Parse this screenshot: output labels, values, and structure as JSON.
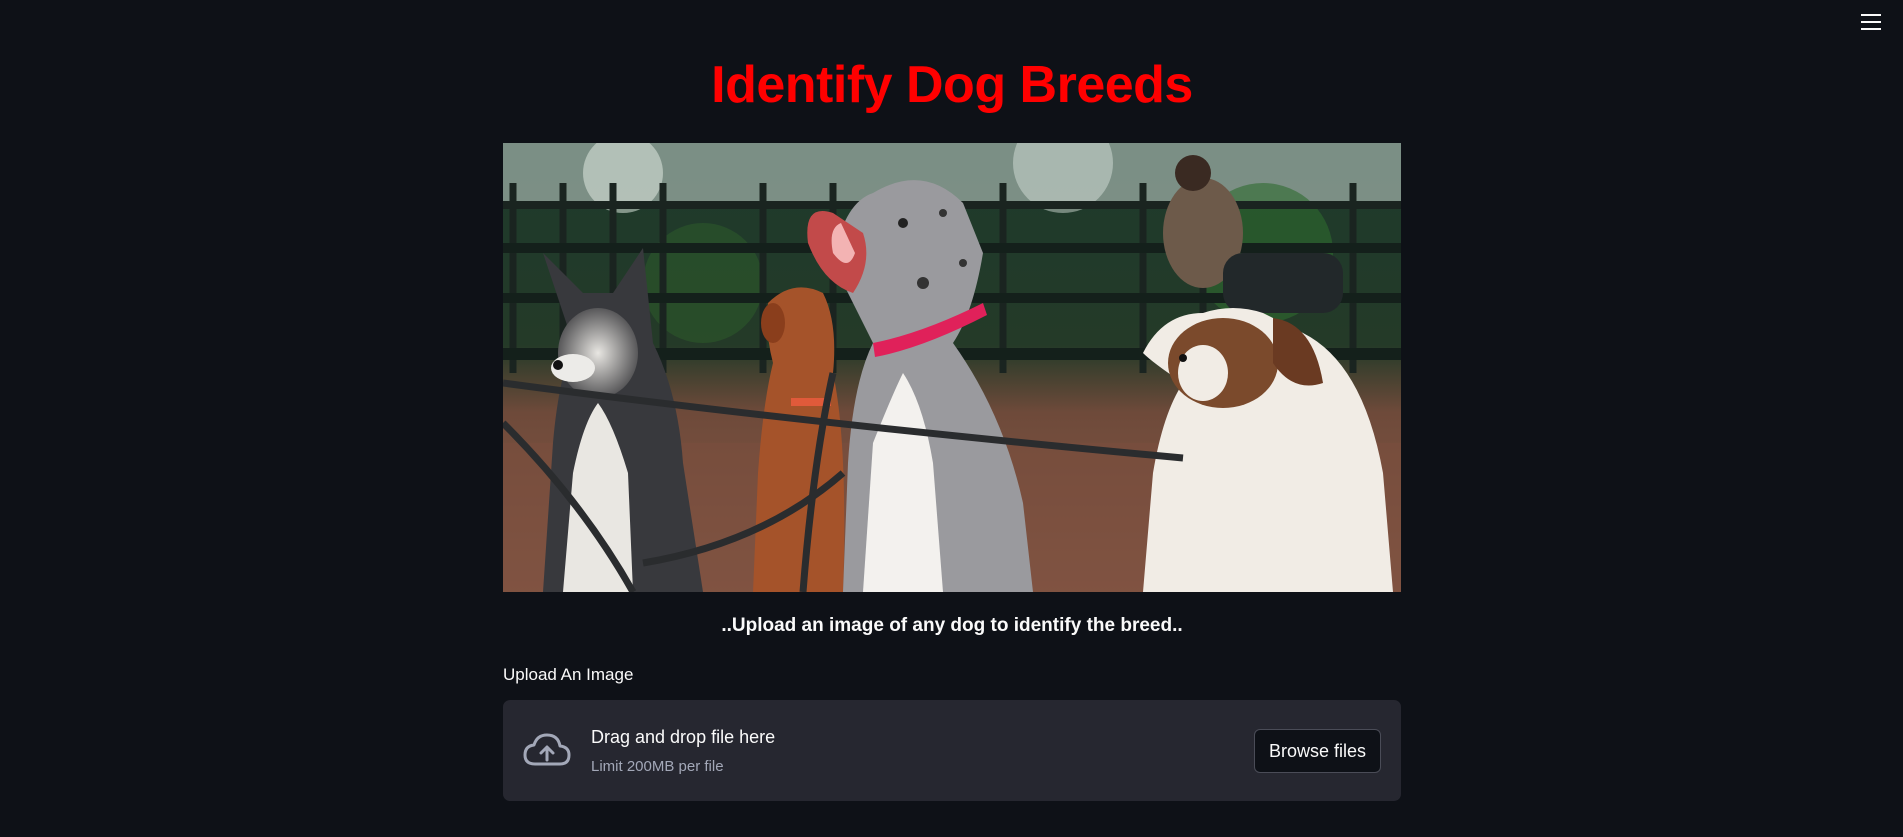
{
  "header": {
    "menu_icon": "hamburger-menu-icon"
  },
  "main": {
    "title": "Identify Dog Breeds",
    "subtitle": "..Upload an image of any dog to identify the breed.."
  },
  "uploader": {
    "label": "Upload An Image",
    "drop_title": "Drag and drop file here",
    "limit": "Limit 200MB per file",
    "browse_label": "Browse files",
    "icon": "cloud-upload-icon"
  },
  "colors": {
    "background": "#0e1117",
    "title": "#ff0000",
    "dropzone": "#262730"
  }
}
